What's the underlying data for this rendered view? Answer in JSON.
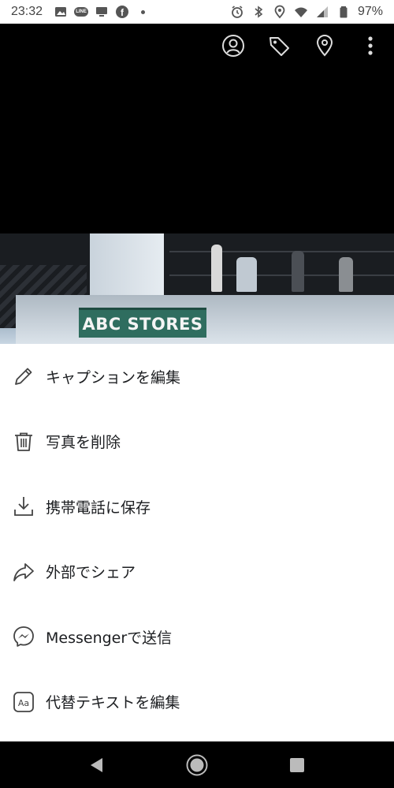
{
  "status_bar": {
    "time": "23:32",
    "line_label": "LINE",
    "facebook_letter": "f",
    "battery": "97%"
  },
  "photo": {
    "sign_text": "ABC STORES"
  },
  "menu": {
    "items": [
      {
        "label": "キャプションを編集",
        "icon": "pencil-icon"
      },
      {
        "label": "写真を削除",
        "icon": "trash-icon"
      },
      {
        "label": "携帯電話に保存",
        "icon": "download-icon"
      },
      {
        "label": "外部でシェア",
        "icon": "share-arrow-icon"
      },
      {
        "label": "Messengerで送信",
        "icon": "messenger-icon"
      },
      {
        "label": "代替テキストを編集",
        "icon": "alt-text-icon"
      }
    ],
    "alt_icon_text": "Aa"
  }
}
